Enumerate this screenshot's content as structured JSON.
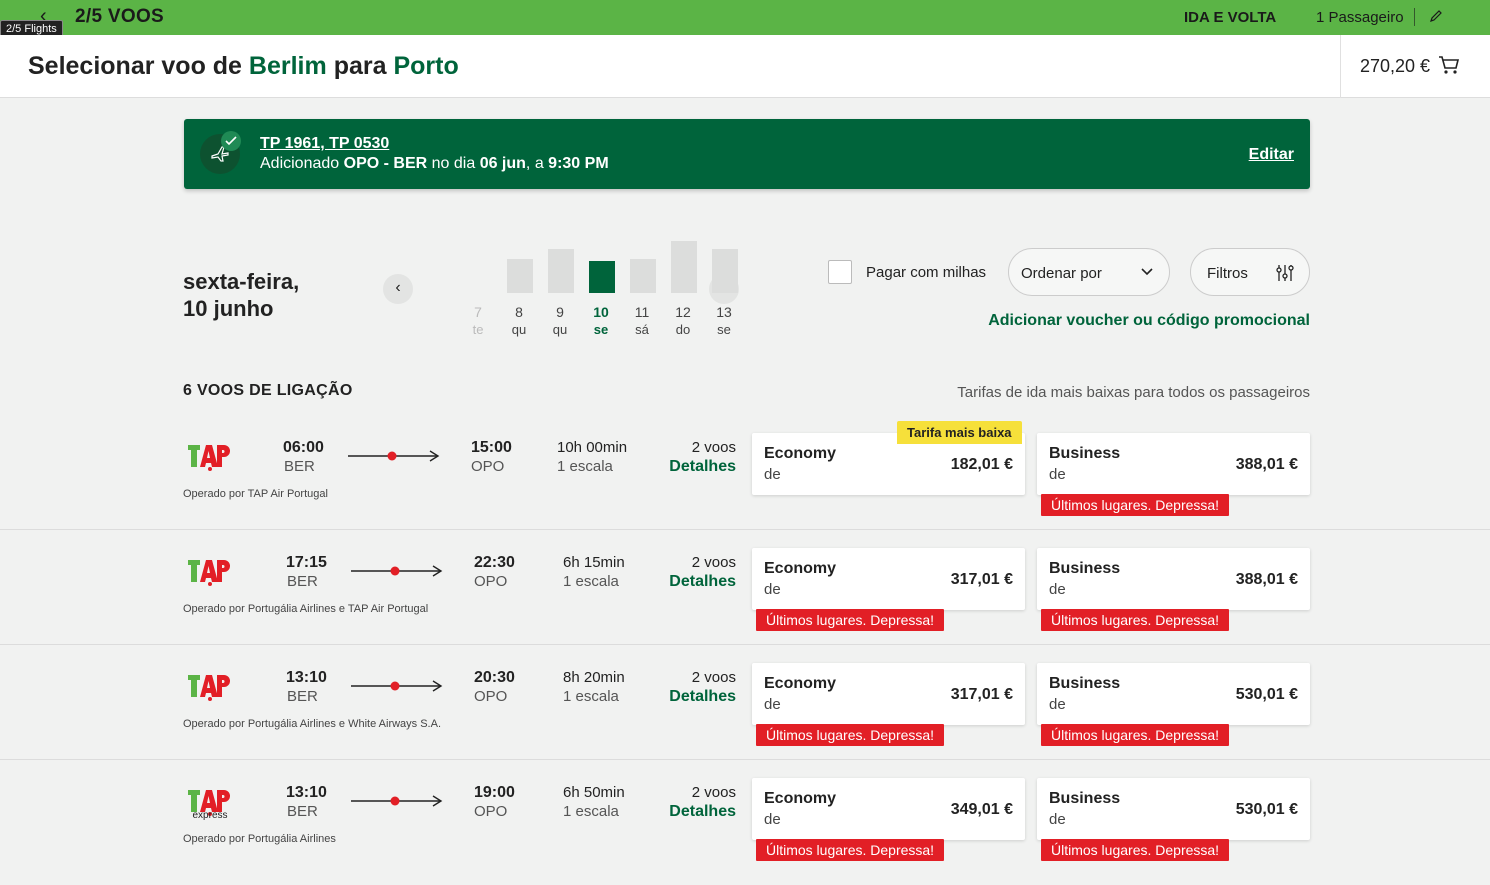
{
  "topbar": {
    "back_icon": "chevron-left-icon",
    "step": "2/5 VOOS",
    "tooltip": "2/5 Flights",
    "trip_type": "IDA E VOLTA",
    "passengers": "1 Passageiro",
    "edit_icon": "pencil-icon",
    "bg_color": "#5bb446"
  },
  "header": {
    "title_prefix": "Selecionar voo de",
    "origin": "Berlim",
    "title_mid": "para",
    "destination": "Porto",
    "total": "270,20 €",
    "cart_icon": "cart-icon"
  },
  "banner": {
    "flights": "TP 1961, TP 0530",
    "added_prefix": "Adicionado",
    "route": "OPO - BER",
    "date_prefix": "no dia",
    "date": "06 jun",
    "time_prefix": ", a",
    "time": "9:30 PM",
    "edit": "Editar",
    "brand_color": "#00643b"
  },
  "date_selector": {
    "weekday": "sexta-feira,",
    "date": "10 junho",
    "days": [
      {
        "num": "7",
        "wk": "te",
        "level": 0,
        "state": "disabled"
      },
      {
        "num": "8",
        "wk": "qu",
        "level": 0.45,
        "state": "normal"
      },
      {
        "num": "9",
        "wk": "qu",
        "level": 0.58,
        "state": "normal"
      },
      {
        "num": "10",
        "wk": "se",
        "level": 0.42,
        "state": "selected"
      },
      {
        "num": "11",
        "wk": "sá",
        "level": 0.45,
        "state": "normal"
      },
      {
        "num": "12",
        "wk": "do",
        "level": 0.68,
        "state": "normal"
      },
      {
        "num": "13",
        "wk": "se",
        "level": 0.58,
        "state": "normal"
      }
    ]
  },
  "controls": {
    "miles_label": "Pagar com milhas",
    "sort_label": "Ordenar por",
    "filter_label": "Filtros",
    "voucher": "Adicionar voucher ou código promocional"
  },
  "results": {
    "count": "6 VOOS DE LIGAÇÃO",
    "note": "Tarifas de ida mais baixas para todos os passageiros",
    "lowest_badge": "Tarifa mais baixa",
    "urgent_label": "Últimos lugares. Depressa!",
    "de_label": "de",
    "details_label": "Detalhes",
    "flights": [
      {
        "logo": "tap-logo",
        "dep": "06:00",
        "dep_code": "BER",
        "arr": "15:00",
        "arr_code": "OPO",
        "duration": "10h 00min",
        "stops": "1 escala",
        "n_flights": "2 voos",
        "operated": "Operado por TAP Air Portugal",
        "economy": {
          "label": "Economy",
          "price": "182,01 €",
          "urgent": false
        },
        "business": {
          "label": "Business",
          "price": "388,01 €",
          "urgent": true
        }
      },
      {
        "logo": "tap-logo",
        "dep": "17:15",
        "dep_code": "BER",
        "arr": "22:30",
        "arr_code": "OPO",
        "duration": "6h 15min",
        "stops": "1 escala",
        "n_flights": "2 voos",
        "operated": "Operado por Portugália Airlines e TAP Air Portugal",
        "economy": {
          "label": "Economy",
          "price": "317,01 €",
          "urgent": true
        },
        "business": {
          "label": "Business",
          "price": "388,01 €",
          "urgent": true
        }
      },
      {
        "logo": "tap-logo",
        "dep": "13:10",
        "dep_code": "BER",
        "arr": "20:30",
        "arr_code": "OPO",
        "duration": "8h 20min",
        "stops": "1 escala",
        "n_flights": "2 voos",
        "operated": "Operado por Portugália Airlines e White Airways S.A.",
        "economy": {
          "label": "Economy",
          "price": "317,01 €",
          "urgent": true
        },
        "business": {
          "label": "Business",
          "price": "530,01 €",
          "urgent": true
        }
      },
      {
        "logo": "tap-express-logo",
        "logo_sub": "express",
        "dep": "13:10",
        "dep_code": "BER",
        "arr": "19:00",
        "arr_code": "OPO",
        "duration": "6h 50min",
        "stops": "1 escala",
        "n_flights": "2 voos",
        "operated": "Operado por Portugália Airlines",
        "economy": {
          "label": "Economy",
          "price": "349,01 €",
          "urgent": true
        },
        "business": {
          "label": "Business",
          "price": "530,01 €",
          "urgent": true
        }
      }
    ]
  },
  "colors": {
    "green": "#00643b",
    "urgent": "#e21f26",
    "badge": "#f6e03a",
    "tap_red": "#e21f26",
    "tap_green": "#5bb446"
  }
}
